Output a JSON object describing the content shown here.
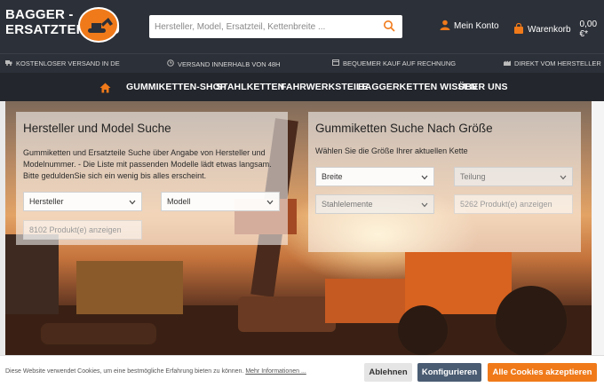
{
  "brand": {
    "line1": "BAGGER -",
    "line2": "ERSATZTEILE.EU"
  },
  "search": {
    "placeholder": "Hersteller, Model, Ersatzteil, Kettenbreite ..."
  },
  "account": {
    "label": "Mein Konto"
  },
  "cart": {
    "label": "Warenkorb",
    "total": "0,00 €*"
  },
  "usp": [
    {
      "text": "KOSTENLOSER VERSAND IN DE",
      "icon": "truck-icon"
    },
    {
      "text": "VERSAND INNERHALB VON 48H",
      "icon": "clock-icon"
    },
    {
      "text": "BEQUEMER KAUF AUF RECHNUNG",
      "icon": "invoice-icon"
    },
    {
      "text": "DIREKT VOM HERSTELLER",
      "icon": "factory-icon"
    }
  ],
  "nav": {
    "items": [
      "GUMMIKETTEN-SHOP",
      "STAHLKETTEN",
      "FAHRWERKSTEILE",
      "BAGGERKETTEN WISSEN",
      "ÜBER UNS"
    ]
  },
  "left_panel": {
    "title": "Hersteller und Model Suche",
    "text": "Gummiketten und Ersatzteile Suche über Angabe von Hersteller und Modelnummer. - Die Liste mit passenden Modelle lädt etwas langsam. Bitte geduldenSie sich ein wenig bis alles erscheint.",
    "select_manufacturer": "Hersteller",
    "select_model": "Modell",
    "result_button": "8102 Produkt(e) anzeigen"
  },
  "right_panel": {
    "title": "Gummiketten Suche Nach Größe",
    "text": "Wählen Sie die Größe Ihrer aktuellen Kette",
    "select_width": "Breite",
    "select_pitch": "Teilung",
    "select_links": "Stahlelemente",
    "result_button": "5262 Produkt(e) anzeigen"
  },
  "cookie": {
    "text": "Diese Website verwendet Cookies, um eine bestmögliche Erfahrung bieten zu können.",
    "link": "Mehr Informationen ...",
    "decline": "Ablehnen",
    "configure": "Konfigurieren",
    "accept": "Alle Cookies akzeptieren"
  },
  "colors": {
    "accent": "#f07a1a",
    "header_bg": "#2c3038",
    "nav_bg": "#23262c",
    "configure_bg": "#4a5c72"
  }
}
